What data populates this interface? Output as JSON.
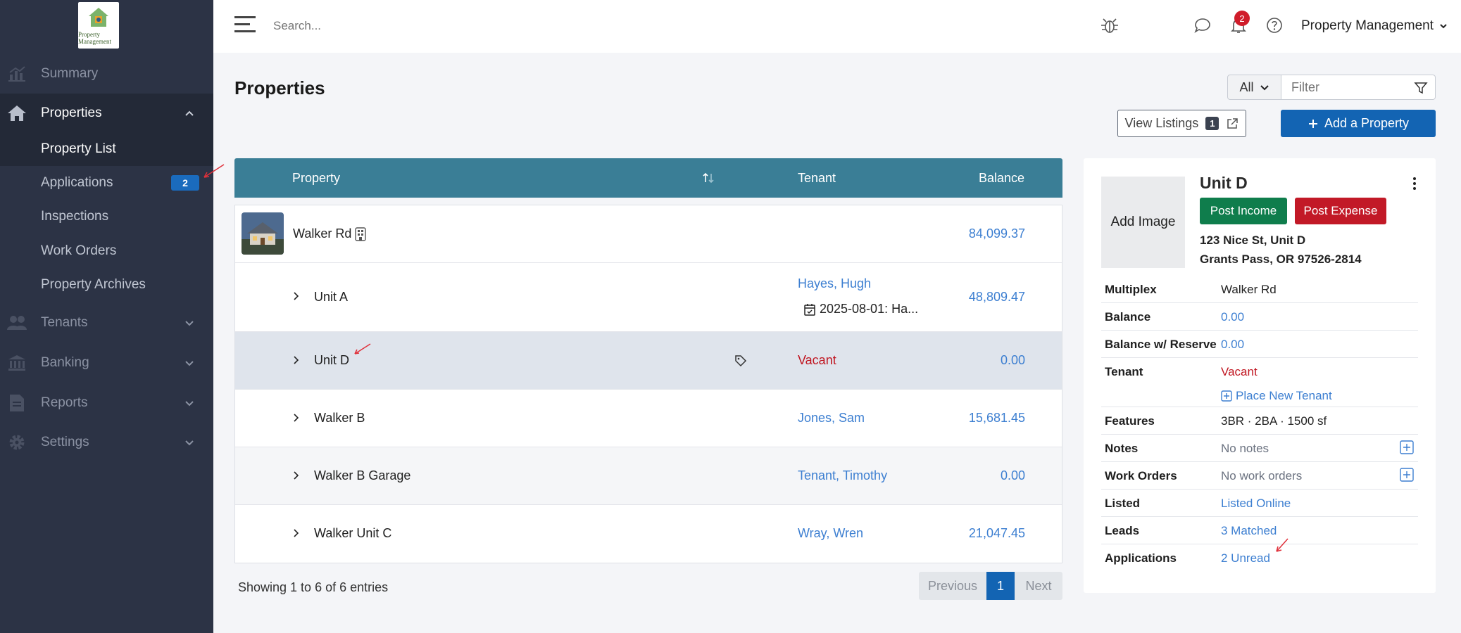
{
  "sidebar": {
    "logo_text": "Property Management",
    "items": [
      {
        "label": "Summary",
        "icon": "chart-icon"
      },
      {
        "label": "Properties",
        "icon": "home-icon"
      },
      {
        "label": "Tenants",
        "icon": "users-icon"
      },
      {
        "label": "Banking",
        "icon": "bank-icon"
      },
      {
        "label": "Reports",
        "icon": "report-icon"
      },
      {
        "label": "Settings",
        "icon": "gear-icon"
      }
    ],
    "sub_items": [
      {
        "label": "Property List"
      },
      {
        "label": "Applications",
        "badge": "2"
      },
      {
        "label": "Inspections"
      },
      {
        "label": "Work Orders"
      },
      {
        "label": "Property Archives"
      }
    ]
  },
  "topbar": {
    "search_placeholder": "Search...",
    "notification_count": "2",
    "account_label": "Property Management"
  },
  "main": {
    "title": "Properties",
    "filter": {
      "select_value": "All",
      "placeholder": "Filter"
    },
    "view_listings": {
      "label": "View Listings",
      "count": "1"
    },
    "add_property_label": "Add a Property"
  },
  "table": {
    "columns": {
      "property": "Property",
      "tenant": "Tenant",
      "balance": "Balance"
    },
    "rows": [
      {
        "name": "Walker Rd",
        "tenant": "",
        "balance": "84,099.37"
      },
      {
        "name": "Unit A",
        "tenant": "Hayes, Hugh",
        "lease": "2025-08-01: Ha...",
        "balance": "48,809.47"
      },
      {
        "name": "Unit D",
        "tenant": "Vacant",
        "balance": "0.00"
      },
      {
        "name": "Walker B",
        "tenant": "Jones, Sam",
        "balance": "15,681.45"
      },
      {
        "name": "Walker B Garage",
        "tenant": "Tenant, Timothy",
        "balance": "0.00"
      },
      {
        "name": "Walker Unit C",
        "tenant": "Wray, Wren",
        "balance": "21,047.45"
      }
    ],
    "showing": "Showing 1 to 6 of 6 entries",
    "pager": {
      "previous": "Previous",
      "page": "1",
      "next": "Next"
    }
  },
  "detail": {
    "add_image": "Add Image",
    "title": "Unit D",
    "post_income": "Post Income",
    "post_expense": "Post Expense",
    "address_line1": "123 Nice St, Unit D",
    "address_line2": "Grants Pass, OR 97526-2814",
    "fields": {
      "multiplex": {
        "label": "Multiplex",
        "value": "Walker Rd"
      },
      "balance": {
        "label": "Balance",
        "value": "0.00"
      },
      "balance_reserve": {
        "label": "Balance w/ Reserve",
        "value": "0.00"
      },
      "tenant": {
        "label": "Tenant",
        "value": "Vacant",
        "action": "Place New Tenant"
      },
      "features": {
        "label": "Features",
        "value": "3BR · 2BA · 1500 sf"
      },
      "notes": {
        "label": "Notes",
        "value": "No notes"
      },
      "work_orders": {
        "label": "Work Orders",
        "value": "No work orders"
      },
      "listed": {
        "label": "Listed",
        "value": "Listed Online"
      },
      "leads": {
        "label": "Leads",
        "value": "3 Matched"
      },
      "applications": {
        "label": "Applications",
        "value": "2 Unread"
      }
    }
  },
  "colors": {
    "sidebar_bg": "#2c3345",
    "table_header": "#3a7e96",
    "primary": "#1364b3",
    "success": "#0f7d4c",
    "danger": "#c21927",
    "link": "#3d7fd1",
    "annotation_arrow": "#e0303a"
  }
}
